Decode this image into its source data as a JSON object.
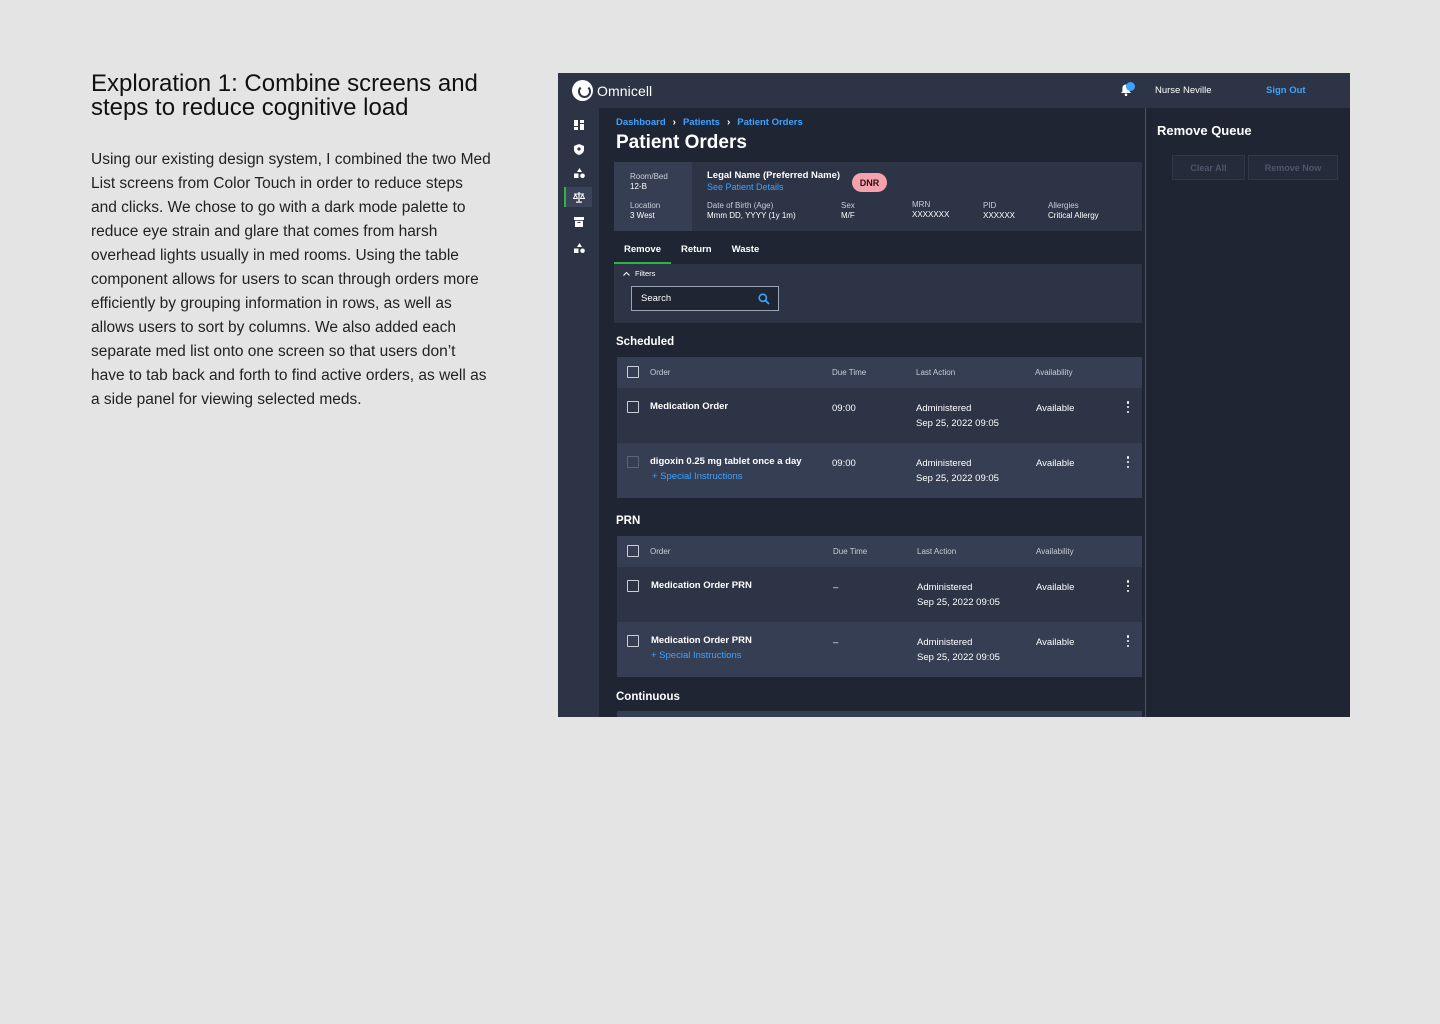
{
  "case": {
    "title": "Exploration 1: Combine screens and steps to reduce cognitive load",
    "body": "Using our existing design system, I combined the two Med List screens from Color Touch in order to reduce steps and clicks. We chose to go with a dark mode palette to reduce eye strain and glare that comes from harsh overhead lights usually in med rooms.  Using the table component allows for users to scan through orders more efficiently by grouping information in rows, as well as allows users to sort by columns.  We also added each separate med list onto one screen so that users don’t have to tab back and forth to find active orders, as well as a side panel for viewing selected meds."
  },
  "app": {
    "brand": "Omnicell",
    "user": "Nurse Neville",
    "sign_out": "Sign Out",
    "nav_icons": [
      "dashboard-icon",
      "shield-icon",
      "shapes-icon",
      "scale-icon",
      "archive-icon",
      "shapes-alt-icon"
    ],
    "breadcrumb": [
      "Dashboard",
      "Patients",
      "Patient Orders"
    ],
    "page_title": "Patient Orders",
    "patient": {
      "room_label": "Room/Bed",
      "room_value": "12-B",
      "location_label": "Location",
      "location_value": "3 West",
      "name": "Legal Name (Preferred Name)",
      "details_link": "See Patient Details",
      "dnr": "DNR",
      "dob_label": "Date of Birth (Age)",
      "dob_value": "Mmm DD, YYYY (1y 1m)",
      "sex_label": "Sex",
      "sex_value": "M/F",
      "mrn_label": "MRN",
      "mrn_value": "XXXXXXX",
      "pid_label": "PID",
      "pid_value": "XXXXXX",
      "allergies_label": "Allergies",
      "allergies_value": "Critical Allergy"
    },
    "tabs": [
      "Remove",
      "Return",
      "Waste"
    ],
    "filters_label": "Filters",
    "search_placeholder": "Search",
    "columns": [
      "Order",
      "Due Time",
      "Last Action",
      "Availability"
    ],
    "scheduled": {
      "title": "Scheduled",
      "rows": [
        {
          "order": "Medication Order",
          "link": "",
          "due": "09:00",
          "action": "Administered",
          "date": "Sep 25, 2022 09:05",
          "availability": "Available"
        },
        {
          "order": "digoxin 0.25 mg tablet once a day",
          "link": "+ Special Instructions",
          "due": "09:00",
          "action": "Administered",
          "date": "Sep 25, 2022 09:05",
          "availability": "Available"
        }
      ]
    },
    "prn": {
      "title": "PRN",
      "rows": [
        {
          "order": "Medication Order PRN",
          "link": "",
          "due": "–",
          "action": "Administered",
          "date": "Sep 25, 2022 09:05",
          "availability": "Available"
        },
        {
          "order": "Medication Order PRN",
          "link": "+ Special Instructions",
          "due": "–",
          "action": "Administered",
          "date": "Sep 25, 2022 09:05",
          "availability": "Available"
        }
      ]
    },
    "continuous_title": "Continuous",
    "queue": {
      "title": "Remove Queue",
      "clear_all": "Clear All",
      "remove_now": "Remove Now"
    },
    "colors": {
      "accent_blue": "#3ea3ff",
      "active_green": "#2fb344",
      "dnr_pink": "#f4a3ad",
      "background": "#1f2533",
      "panel": "#2c3446"
    }
  }
}
